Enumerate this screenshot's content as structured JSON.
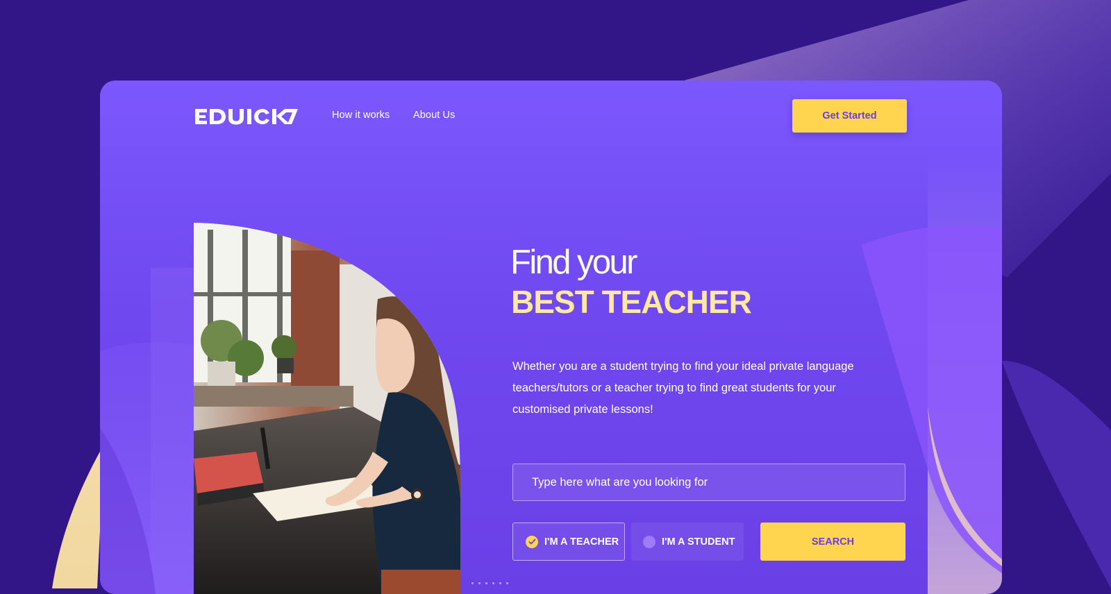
{
  "brand": {
    "logo_text": "EDUICK"
  },
  "nav": {
    "links": [
      {
        "label": "How it works"
      },
      {
        "label": "About Us"
      }
    ],
    "cta_label": "Get Started"
  },
  "hero": {
    "headline_line1": "Find your",
    "headline_line2": "BEST TEACHER",
    "subtext": "Whether you are a student trying to find your ideal private language teachers/tutors or a teacher trying to find great students for your customised private lessons!",
    "photo_description_icon": "woman-writing-photo"
  },
  "search": {
    "placeholder": "Type here what are you looking for",
    "value": "",
    "role_options": [
      {
        "label": "I'M A TEACHER",
        "selected": true
      },
      {
        "label": "I'M A STUDENT",
        "selected": false
      }
    ],
    "submit_label": "SEARCH"
  },
  "colors": {
    "page_bg": "#321587",
    "card_bg": "#7b58fd",
    "accent_yellow": "#ffd44f",
    "headline_highlight": "#fde9a2",
    "button_text": "#6a3ee4"
  }
}
